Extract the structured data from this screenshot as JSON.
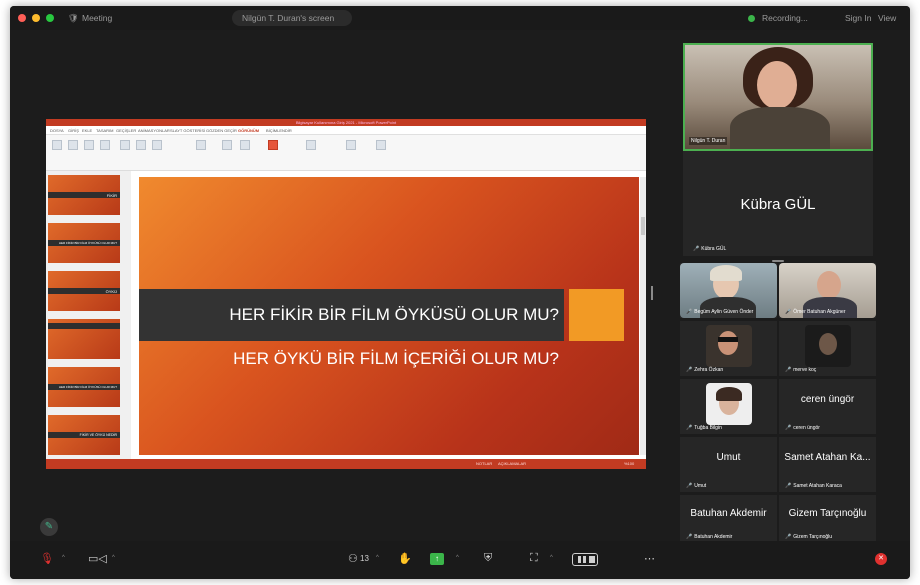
{
  "topbar": {
    "meeting_label": "Meeting",
    "share_title": "Nilgün T. Duran's screen",
    "recording_label": "Recording...",
    "sign_in": "Sign In",
    "view": "View"
  },
  "ppt": {
    "window_title": "Bilgisayar Kullanımına Giriş 2021 - Microsoft PowerPoint",
    "tabs": [
      "DOSYA",
      "GİRİŞ",
      "EKLE",
      "TASARIM",
      "GEÇİŞLER",
      "ANİMASYONLAR",
      "SLAYT GÖSTERİSİ",
      "GÖZDEN GEÇİR",
      "GÖRÜNÜM",
      "BİÇİMLENDİR"
    ],
    "thumbnails": [
      {
        "text": "FİKİR"
      },
      {
        "text": "HER FİKİR BİR FİLM ÖYKÜSÜ OLUR MU?"
      },
      {
        "text": "ÖYKÜ"
      },
      {
        "text": ""
      },
      {
        "text": "HER FİKİR BİR FİLM ÖYKÜSÜ OLUR MU?"
      },
      {
        "text": "FİKİR VE ÖYKÜ NEDİR"
      }
    ],
    "slide": {
      "line1": "HER FİKİR BİR FİLM ÖYKÜSÜ OLUR MU?",
      "line2": "HER ÖYKÜ BİR FİLM İÇERİĞİ OLUR MU?"
    },
    "status_notes": "NOTLAR",
    "status_comments": "AÇIKLAMALAR",
    "status_zoom": "%100"
  },
  "speaker": {
    "name": "Nilgün T. Duran"
  },
  "kubra": {
    "big": "Kübra GÜL",
    "small": "Kübra GÜL"
  },
  "gallery": [
    {
      "name": "Begüm Aylin Güven Önder",
      "big": ""
    },
    {
      "name": "Ömer Batuhan Akgüner",
      "big": ""
    },
    {
      "name": "Zehra Özkan",
      "big": ""
    },
    {
      "name": "merve koç",
      "big": ""
    },
    {
      "name": "Tuğba Bilgin",
      "big": ""
    },
    {
      "name": "ceren üngör",
      "big": "ceren üngör"
    },
    {
      "name": "Umut",
      "big": "Umut"
    },
    {
      "name": "Samet Atahan Karaca",
      "big": "Samet Atahan Ka..."
    },
    {
      "name": "Batuhan Akdemir",
      "big": "Batuhan Akdemir"
    },
    {
      "name": "Gizem Tarçınoğlu",
      "big": "Gizem Tarçınoğlu"
    }
  ],
  "toolbar": {
    "participants_count": "13"
  },
  "colors": {
    "active_speaker": "#4caf50",
    "share_green": "#3bb54a",
    "end_red": "#e0312f",
    "ppt_red": "#c23b22",
    "slide_accent": "#f29a25"
  }
}
